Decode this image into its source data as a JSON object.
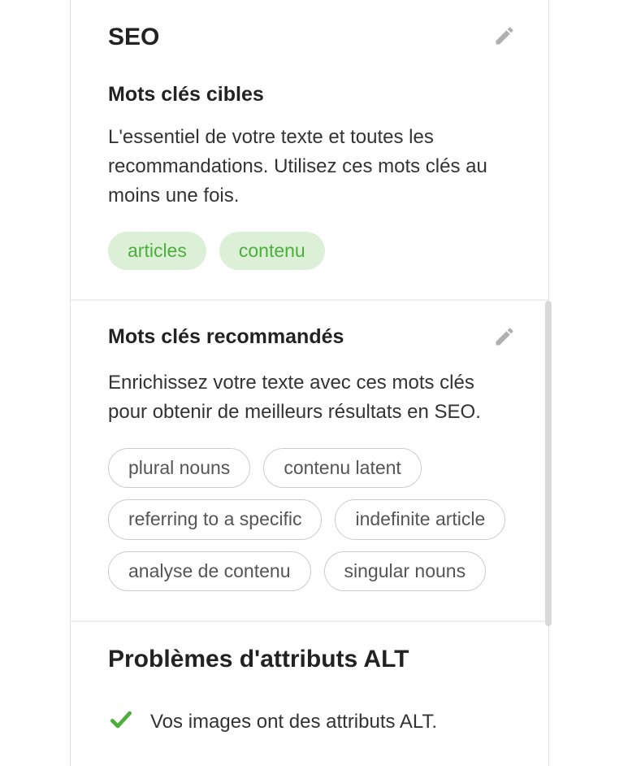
{
  "seo": {
    "title": "SEO",
    "target_keywords": {
      "heading": "Mots clés cibles",
      "description": "L'essentiel de votre texte et toutes les recommandations. Utilisez ces mots clés au moins une fois.",
      "tags": [
        "articles",
        "contenu"
      ]
    },
    "recommended_keywords": {
      "heading": "Mots clés recommandés",
      "description": "Enrichissez votre texte avec ces mots clés pour obtenir de meilleurs résultats en SEO.",
      "tags": [
        "plural nouns",
        "contenu latent",
        "referring to a specific",
        "indefinite article",
        "analyse de contenu",
        "singular nouns"
      ]
    }
  },
  "alt_issues": {
    "title": "Problèmes d'attributs ALT",
    "status_message": "Vos images ont des attributs ALT."
  }
}
